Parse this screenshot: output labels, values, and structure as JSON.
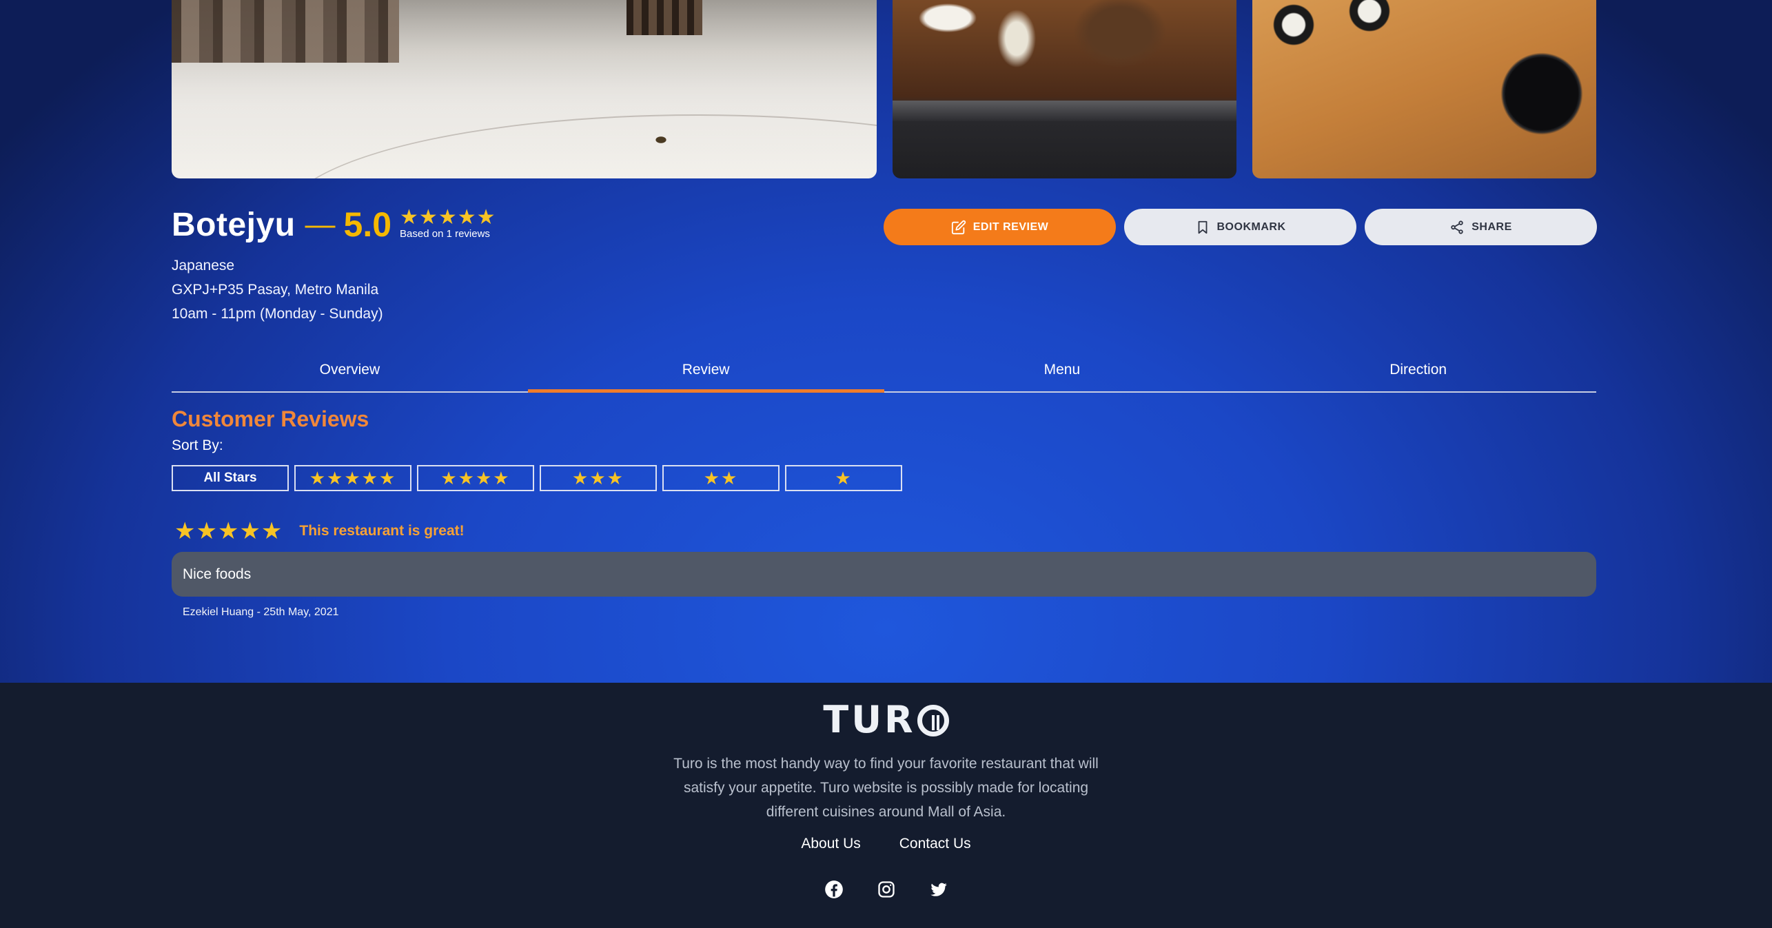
{
  "restaurant": {
    "name": "Botejyu",
    "score": "5.0",
    "stars": "★★★★★",
    "based_on": "Based on 1 reviews",
    "cuisine": "Japanese",
    "address": "GXPJ+P35 Pasay, Metro Manila",
    "hours": "10am - 11pm (Monday - Sunday)",
    "rating": 5
  },
  "actions": {
    "edit_label": "EDIT REVIEW",
    "bookmark_label": "BOOKMARK",
    "share_label": "SHARE"
  },
  "tabs": [
    {
      "label": "Overview",
      "active": false
    },
    {
      "label": "Review",
      "active": true
    },
    {
      "label": "Menu",
      "active": false
    },
    {
      "label": "Direction",
      "active": false
    }
  ],
  "reviews": {
    "heading": "Customer Reviews",
    "sort_label": "Sort By:",
    "filters": [
      "All Stars",
      "★★★★★",
      "★★★★",
      "★★★",
      "★★",
      "★"
    ],
    "items": [
      {
        "stars": "★★★★★",
        "rating": 5,
        "title": "This restaurant is great!",
        "body": "Nice foods",
        "author": "Ezekiel Huang - 25th May, 2021"
      }
    ]
  },
  "footer": {
    "logo": "TUR",
    "about": "Turo is the most handy way to find your favorite restaurant that will satisfy your appetite. Turo website is possibly made for locating different cuisines around Mall of Asia.",
    "links": [
      "About Us",
      "Contact Us"
    ],
    "social": [
      "facebook-icon",
      "instagram-icon",
      "twitter-icon"
    ]
  },
  "colors": {
    "accent_orange": "#f47b1a",
    "star_yellow": "#f7c325",
    "heading_orange": "#f0873a",
    "footer_bg": "#141c2e"
  }
}
